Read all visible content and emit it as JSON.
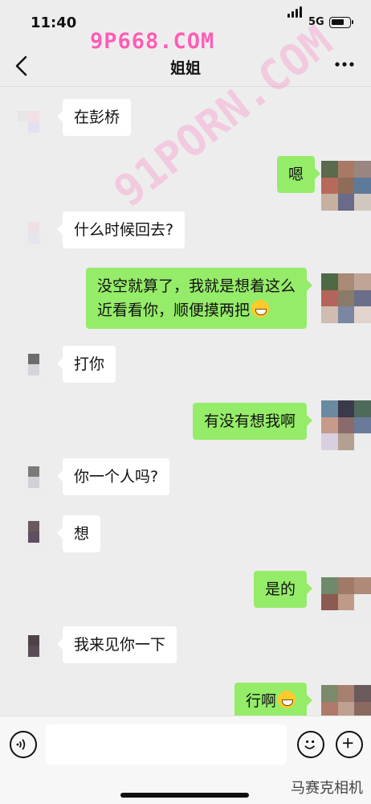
{
  "status_bar": {
    "time": "11:40",
    "network": "5G",
    "battery_level": 0.75
  },
  "watermarks": {
    "top": "9P668.COM",
    "diagonal": "91PORN.COM",
    "corner": "马赛克相机"
  },
  "header": {
    "title": "姐姐",
    "back_icon": "chevron-left-icon",
    "more_icon": "more-dots-icon"
  },
  "messages": [
    {
      "side": "in",
      "text": "在彭桥"
    },
    {
      "side": "out",
      "text": "嗯"
    },
    {
      "side": "in",
      "text": "什么时候回去?"
    },
    {
      "side": "out",
      "line1": "没空就算了，我就是想着这么",
      "line2": "近看看你，顺便摸两把",
      "emoji": "thinking-face-emoji"
    },
    {
      "side": "in",
      "text": "打你"
    },
    {
      "side": "out",
      "text": "有没有想我啊"
    },
    {
      "side": "in",
      "text": "你一个人吗?"
    },
    {
      "side": "in",
      "text": "想"
    },
    {
      "side": "out",
      "text": "是的"
    },
    {
      "side": "in",
      "text": "我来见你一下"
    },
    {
      "side": "out",
      "text": "行啊",
      "emoji": "grinning-face-emoji"
    }
  ],
  "input_bar": {
    "voice_icon": "voice-icon",
    "emoji_icon": "emoji-icon",
    "plus_icon": "plus-icon",
    "placeholder": ""
  },
  "colors": {
    "background": "#ededed",
    "incoming_bubble": "#ffffff",
    "outgoing_bubble": "#95ec69",
    "watermark": "#ff5db5"
  }
}
